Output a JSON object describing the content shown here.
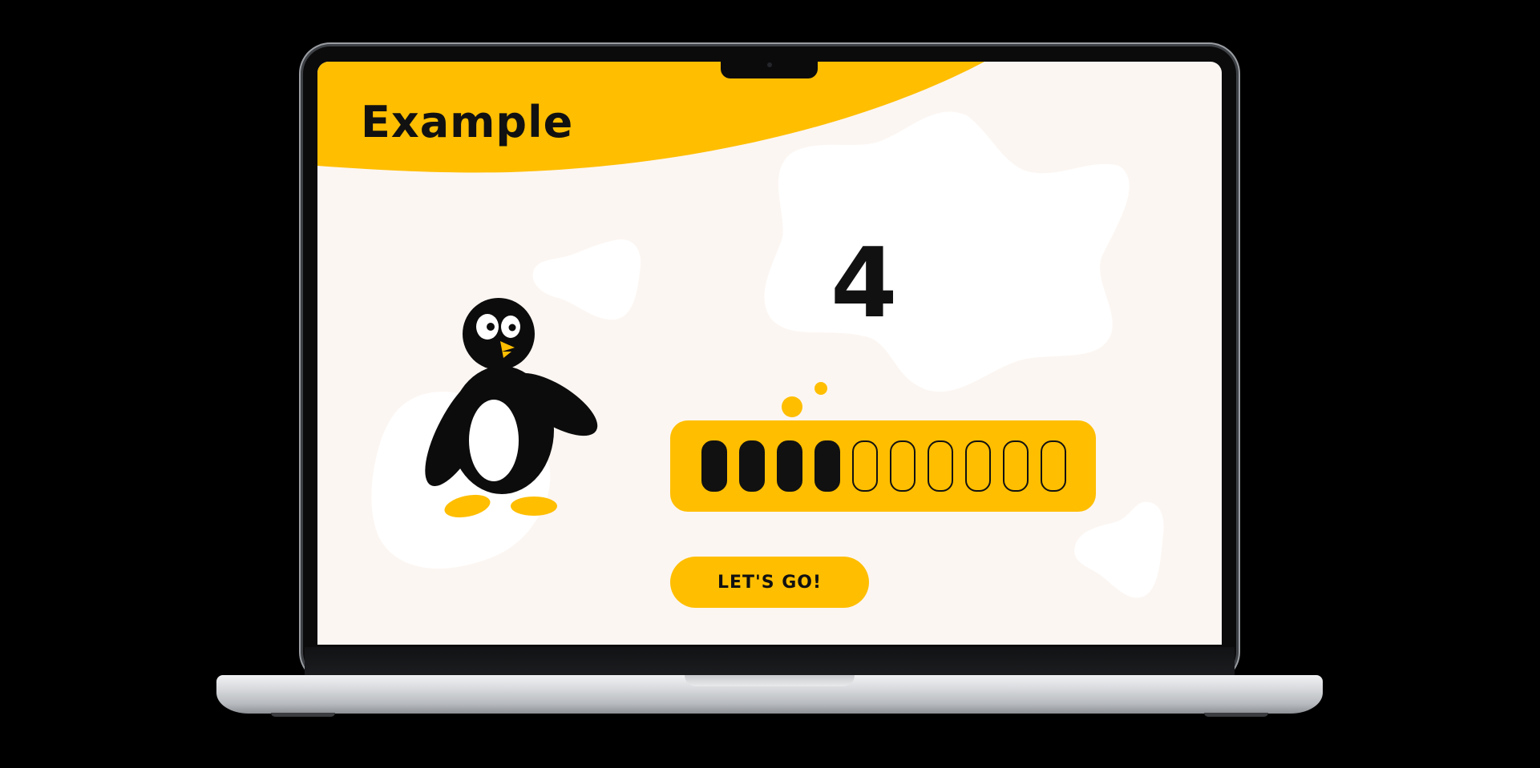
{
  "colors": {
    "accent": "#ffbe00",
    "screen_bg": "#fcf6f2",
    "blob": "#ffffff",
    "ink": "#111111"
  },
  "app": {
    "title": "Example"
  },
  "counter": {
    "value": "4"
  },
  "progress": {
    "filled": 4,
    "total": 10
  },
  "cta": {
    "label": "LET'S GO!"
  },
  "icons": {
    "mascot": "penguin-illustration",
    "bubble": "thought-bubble-dots"
  }
}
